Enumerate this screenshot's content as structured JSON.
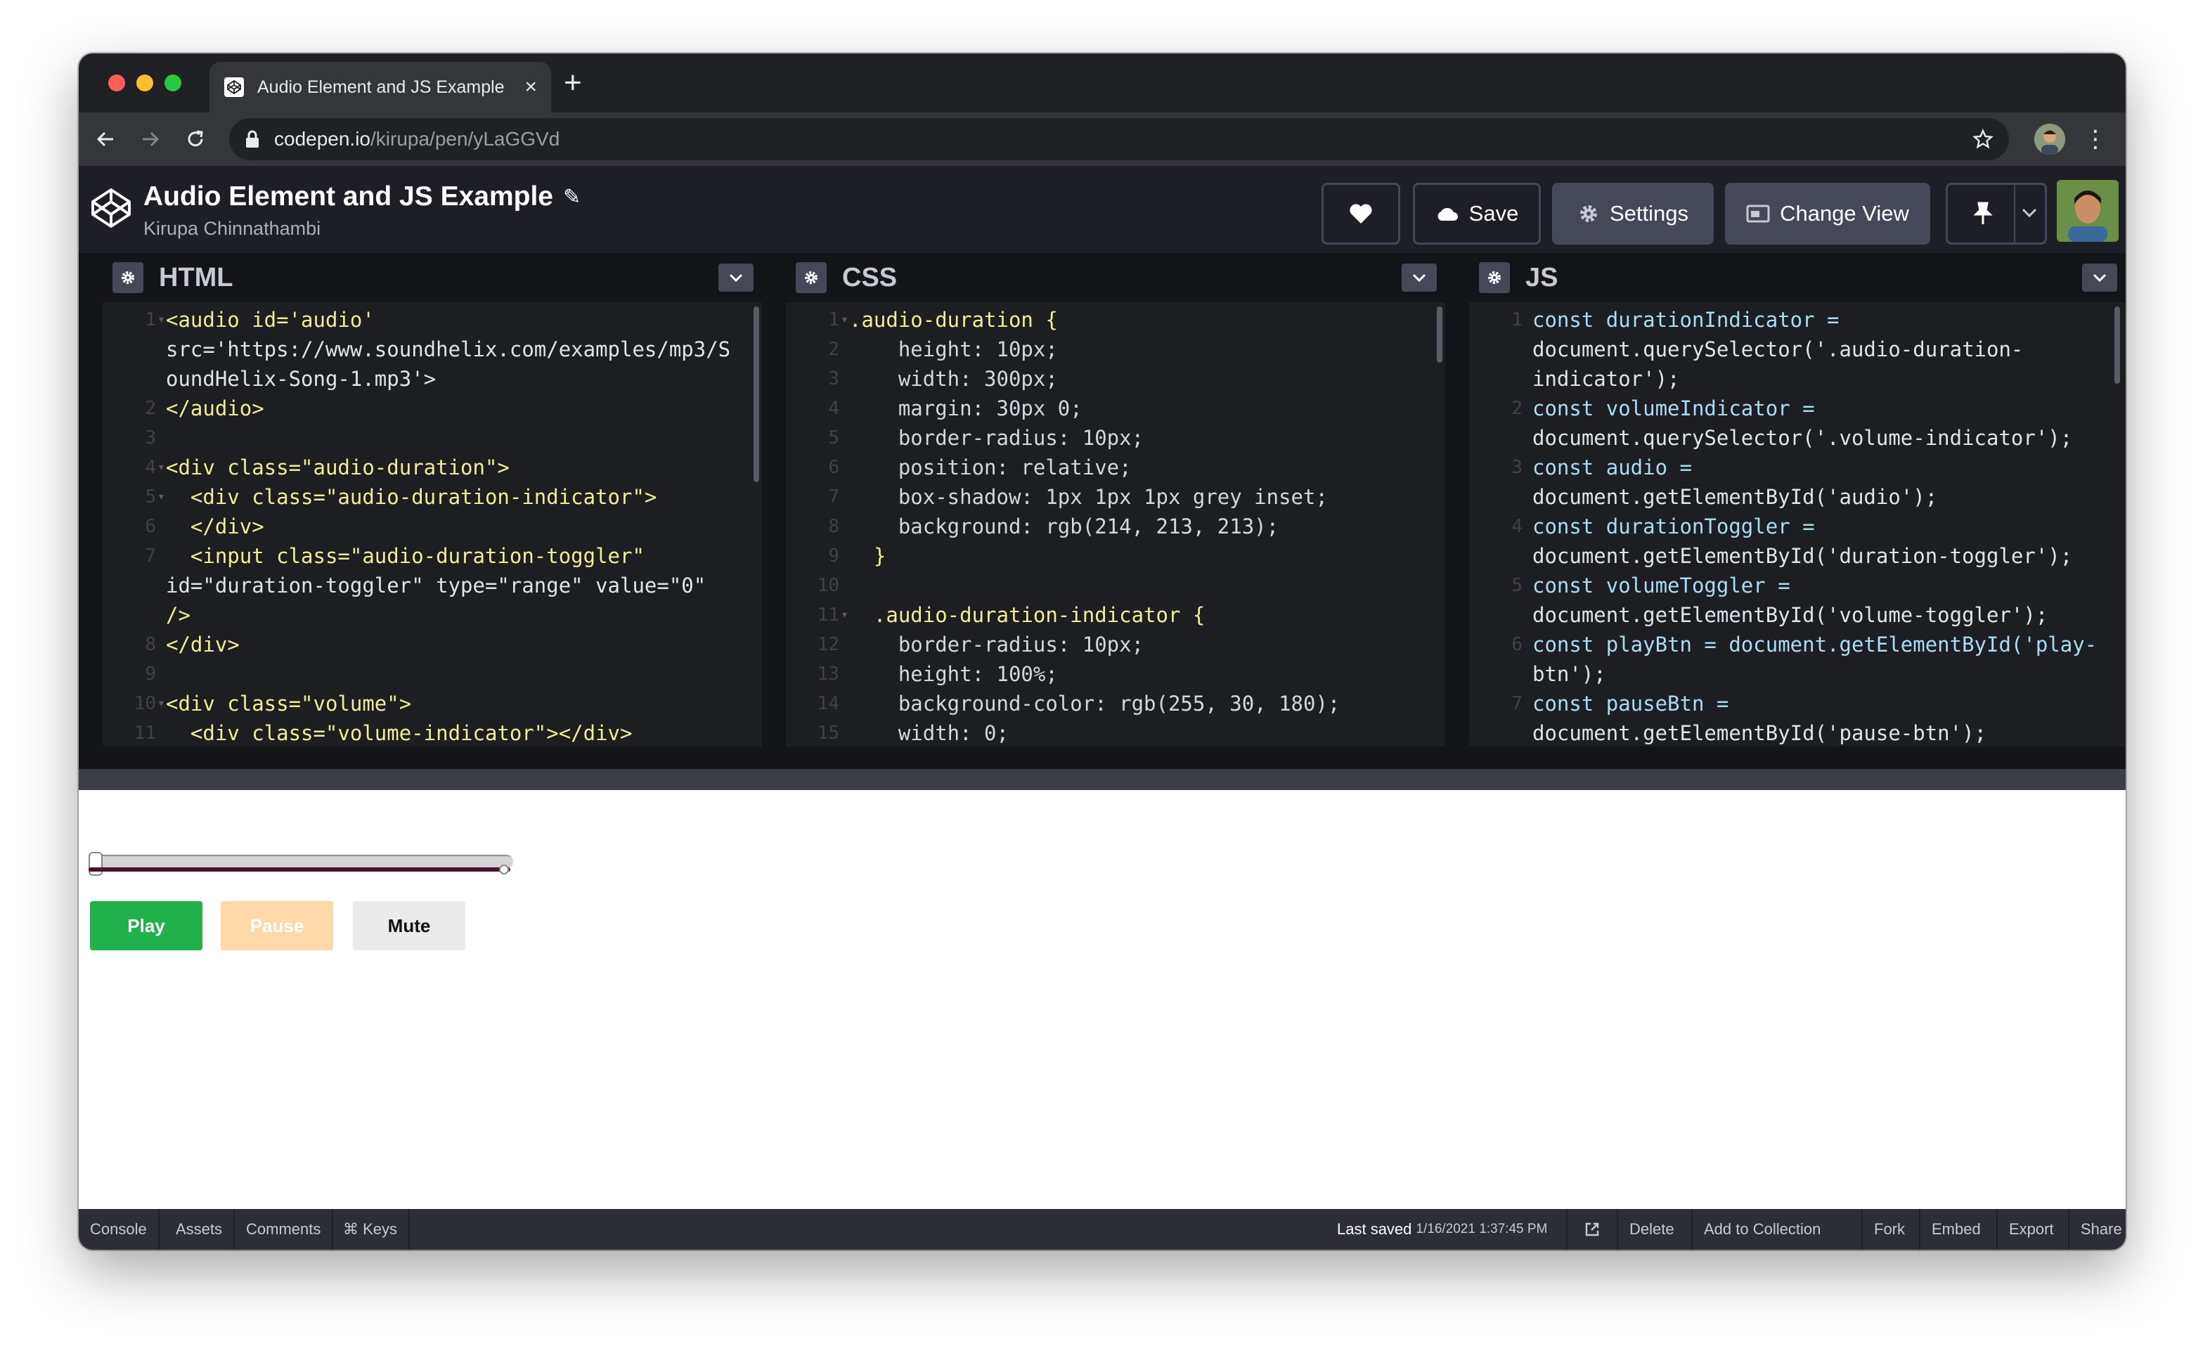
{
  "browser": {
    "tab_title": "Audio Element and JS Example",
    "url_host": "codepen.io",
    "url_path": "/kirupa/pen/yLaGGVd"
  },
  "pen": {
    "title": "Audio Element and JS Example",
    "author": "Kirupa Chinnathambi"
  },
  "header_buttons": {
    "save": "Save",
    "settings": "Settings",
    "change_view": "Change View"
  },
  "panes": {
    "html": {
      "label": "HTML"
    },
    "css": {
      "label": "CSS"
    },
    "js": {
      "label": "JS"
    }
  },
  "html_lines": [
    {
      "n": "1",
      "fold": "▾",
      "text": "<audio id='audio'"
    },
    {
      "n": "",
      "fold": "",
      "text": "src='https://www.soundhelix.com/examples/mp3/S"
    },
    {
      "n": "",
      "fold": "",
      "text": "oundHelix-Song-1.mp3'>"
    },
    {
      "n": "2",
      "fold": "",
      "text": "</audio>"
    },
    {
      "n": "3",
      "fold": "",
      "text": ""
    },
    {
      "n": "4",
      "fold": "▾",
      "text": "<div class=\"audio-duration\">"
    },
    {
      "n": "5",
      "fold": "▾",
      "text": "  <div class=\"audio-duration-indicator\">"
    },
    {
      "n": "6",
      "fold": "",
      "text": "  </div>"
    },
    {
      "n": "7",
      "fold": "",
      "text": "  <input class=\"audio-duration-toggler\""
    },
    {
      "n": "",
      "fold": "",
      "text": "id=\"duration-toggler\" type=\"range\" value=\"0\""
    },
    {
      "n": "",
      "fold": "",
      "text": "/>"
    },
    {
      "n": "8",
      "fold": "",
      "text": "</div>"
    },
    {
      "n": "9",
      "fold": "",
      "text": ""
    },
    {
      "n": "10",
      "fold": "▾",
      "text": "<div class=\"volume\">"
    },
    {
      "n": "11",
      "fold": "",
      "text": "  <div class=\"volume-indicator\"></div>"
    }
  ],
  "css_lines": [
    {
      "n": "1",
      "fold": "▾",
      "text": ".audio-duration {"
    },
    {
      "n": "2",
      "fold": "",
      "text": "    height: 10px;"
    },
    {
      "n": "3",
      "fold": "",
      "text": "    width: 300px;"
    },
    {
      "n": "4",
      "fold": "",
      "text": "    margin: 30px 0;"
    },
    {
      "n": "5",
      "fold": "",
      "text": "    border-radius: 10px;"
    },
    {
      "n": "6",
      "fold": "",
      "text": "    position: relative;"
    },
    {
      "n": "7",
      "fold": "",
      "text": "    box-shadow: 1px 1px 1px grey inset;"
    },
    {
      "n": "8",
      "fold": "",
      "text": "    background: rgb(214, 213, 213);"
    },
    {
      "n": "9",
      "fold": "",
      "text": "  }"
    },
    {
      "n": "10",
      "fold": "",
      "text": ""
    },
    {
      "n": "11",
      "fold": "▾",
      "text": "  .audio-duration-indicator {"
    },
    {
      "n": "12",
      "fold": "",
      "text": "    border-radius: 10px;"
    },
    {
      "n": "13",
      "fold": "",
      "text": "    height: 100%;"
    },
    {
      "n": "14",
      "fold": "",
      "text": "    background-color: rgb(255, 30, 180);"
    },
    {
      "n": "15",
      "fold": "",
      "text": "    width: 0;"
    }
  ],
  "js_lines": [
    {
      "n": "1",
      "fold": "",
      "text": "const durationIndicator ="
    },
    {
      "n": "",
      "fold": "",
      "text": "document.querySelector('.audio-duration-"
    },
    {
      "n": "",
      "fold": "",
      "text": "indicator');"
    },
    {
      "n": "2",
      "fold": "",
      "text": "const volumeIndicator ="
    },
    {
      "n": "",
      "fold": "",
      "text": "document.querySelector('.volume-indicator');"
    },
    {
      "n": "3",
      "fold": "",
      "text": "const audio ="
    },
    {
      "n": "",
      "fold": "",
      "text": "document.getElementById('audio');"
    },
    {
      "n": "4",
      "fold": "",
      "text": "const durationToggler ="
    },
    {
      "n": "",
      "fold": "",
      "text": "document.getElementById('duration-toggler');"
    },
    {
      "n": "5",
      "fold": "",
      "text": "const volumeToggler ="
    },
    {
      "n": "",
      "fold": "",
      "text": "document.getElementById('volume-toggler');"
    },
    {
      "n": "6",
      "fold": "",
      "text": "const playBtn = document.getElementById('play-"
    },
    {
      "n": "",
      "fold": "",
      "text": "btn');"
    },
    {
      "n": "7",
      "fold": "",
      "text": "const pauseBtn ="
    },
    {
      "n": "",
      "fold": "",
      "text": "document.getElementById('pause-btn');"
    }
  ],
  "preview": {
    "duration_value": 0,
    "volume_value": 1,
    "play_label": "Play",
    "pause_label": "Pause",
    "mute_label": "Mute"
  },
  "footer": {
    "console": "Console",
    "assets": "Assets",
    "comments": "Comments",
    "keys": "⌘ Keys",
    "last_saved_label": "Last saved",
    "last_saved_time": "1/16/2021 1:37:45 PM",
    "delete": "Delete",
    "add_to_collection": "Add to Collection",
    "fork": "Fork",
    "embed": "Embed",
    "export": "Export",
    "share": "Share"
  },
  "colors": {
    "accent_green": "#20b14c",
    "pause_peach": "#ffd9a8",
    "editor_bg": "#1d1e22",
    "header_bg": "#1e1f26"
  }
}
